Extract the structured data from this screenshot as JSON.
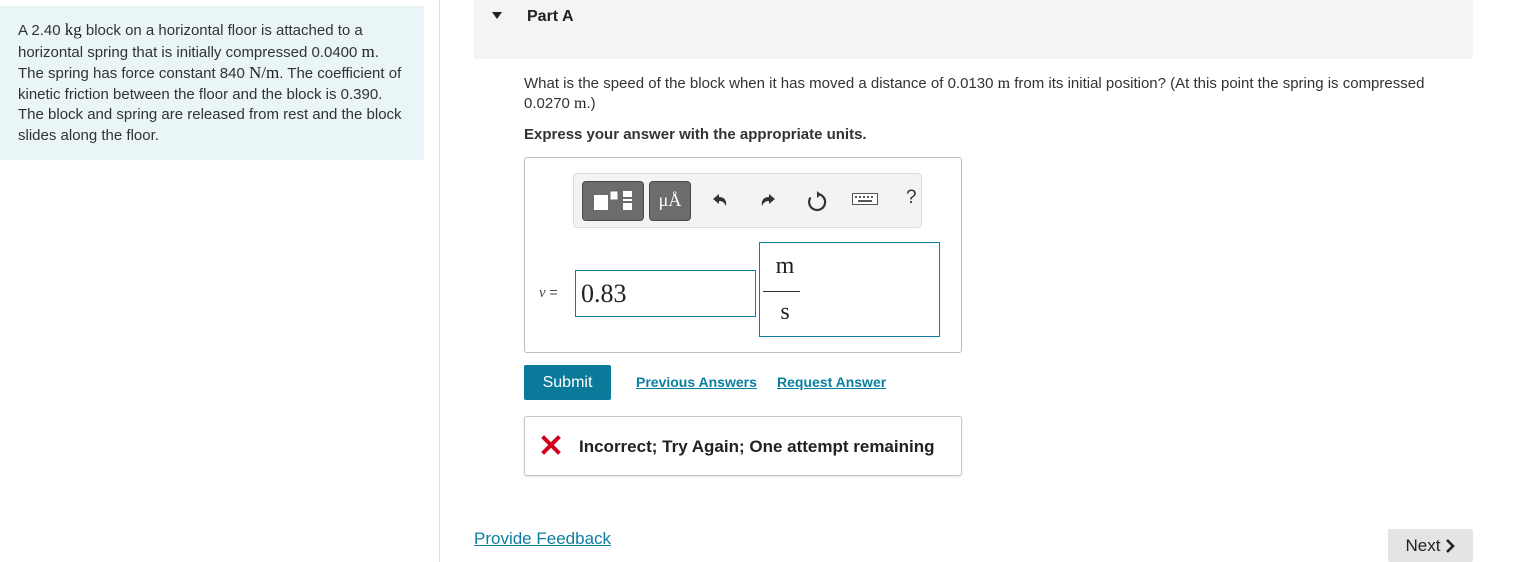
{
  "problem": {
    "seg1": "A 2.40 ",
    "u1": "kg",
    "seg2": " block on a horizontal floor is attached to a horizontal spring that is initially compressed 0.0400 ",
    "u2": "m",
    "seg3": ". The spring has force constant 840 ",
    "u3": "N/m",
    "seg4": ". The coefficient of kinetic friction between the floor and the block is 0.390. The block and spring are released from rest and the block slides along the floor."
  },
  "part": {
    "title": "Part A"
  },
  "question": {
    "seg1": "What is the speed of the block when it has moved a distance of 0.0130 ",
    "u1": "m",
    "seg2": " from its initial position? (At this point the spring is compressed 0.0270 ",
    "u2": "m",
    "seg3": ".)"
  },
  "instruction": "Express your answer with the appropriate units.",
  "toolbar": {
    "symbols_label": "μÅ",
    "help_label": "?",
    "icons": [
      "templates-icon",
      "symbols-icon",
      "undo-icon",
      "redo-icon",
      "reset-icon",
      "keyboard-icon",
      "help-icon"
    ]
  },
  "answer": {
    "variable": "v",
    "equals": " =",
    "value": "0.83",
    "unit_numerator": "m",
    "unit_denominator": "s"
  },
  "actions": {
    "submit_label": "Submit",
    "previous_answers_label": "Previous Answers",
    "request_answer_label": "Request Answer"
  },
  "feedback": {
    "text": "Incorrect; Try Again; One attempt remaining"
  },
  "footer": {
    "provide_feedback_label": "Provide Feedback",
    "next_label": "Next"
  },
  "colors": {
    "accent": "#0a7a9b",
    "panel_bg": "#e9f5f6",
    "error_red": "#d0021b"
  }
}
